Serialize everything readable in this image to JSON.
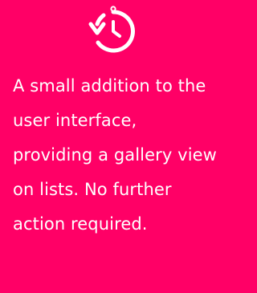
{
  "card": {
    "background_color": "#ff0066",
    "text_color": "#ffffff",
    "icon": "history-clock-icon",
    "description": "A small addition to the user interface, providing a gallery view on lists. No further action required."
  }
}
